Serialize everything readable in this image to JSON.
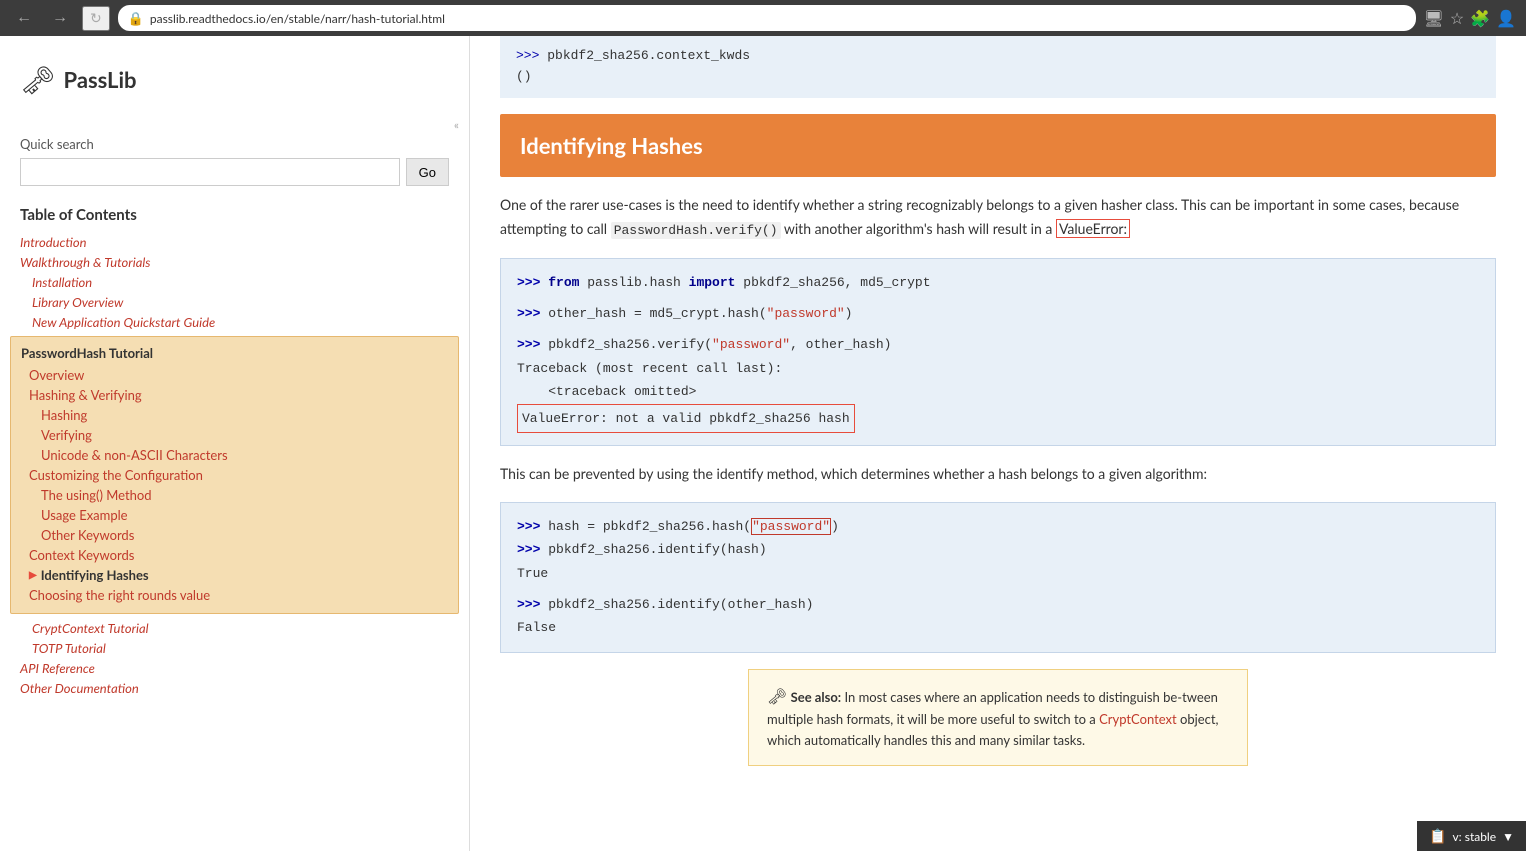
{
  "browser": {
    "url": "passlib.readthedocs.io/en/stable/narr/hash-tutorial.html",
    "back_label": "←",
    "forward_label": "→",
    "refresh_label": "↻",
    "lock_icon": "🔒"
  },
  "sidebar": {
    "logo_icon": "🗝",
    "logo_text": "PassLib",
    "quick_search_label": "Quick search",
    "search_placeholder": "",
    "go_button": "Go",
    "toc_label": "Table of Contents",
    "collapse_icon": "«",
    "nav_items": [
      {
        "label": "Introduction",
        "level": 1,
        "italic": true
      },
      {
        "label": "Walkthrough & Tutorials",
        "level": 1,
        "italic": true
      },
      {
        "label": "Installation",
        "level": 2,
        "italic": true
      },
      {
        "label": "Library Overview",
        "level": 2,
        "italic": true
      },
      {
        "label": "New Application Quickstart Guide",
        "level": 2,
        "italic": true
      }
    ],
    "active_section": {
      "title": "PasswordHash Tutorial",
      "items": [
        {
          "label": "Overview",
          "level": 1
        },
        {
          "label": "Hashing & Verifying",
          "level": 1
        },
        {
          "label": "Hashing",
          "level": 2
        },
        {
          "label": "Verifying",
          "level": 2
        },
        {
          "label": "Unicode & non-ASCII Characters",
          "level": 2
        },
        {
          "label": "Customizing the Configuration",
          "level": 1
        },
        {
          "label": "The using() Method",
          "level": 2
        },
        {
          "label": "Usage Example",
          "level": 2
        },
        {
          "label": "Other Keywords",
          "level": 2
        },
        {
          "label": "Context Keywords",
          "level": 1
        },
        {
          "label": "Identifying Hashes",
          "level": 1,
          "current": true
        },
        {
          "label": "Choosing the right rounds value",
          "level": 1
        }
      ]
    },
    "after_items": [
      {
        "label": "CryptContext Tutorial",
        "level": 1,
        "italic": true
      },
      {
        "label": "TOTP Tutorial",
        "level": 1,
        "italic": true
      },
      {
        "label": "API Reference",
        "level": 0,
        "italic": true
      },
      {
        "label": "Other Documentation",
        "level": 0,
        "italic": true
      }
    ]
  },
  "content": {
    "code_top_lines": [
      ">>> pbkdf2_sha256.context_kwds",
      "()"
    ],
    "section_heading": "Identifying Hashes",
    "paragraph1_parts": [
      {
        "type": "text",
        "text": "One of the rarer use-cases is the need to identify whether a string recognizably belongs to a given hasher class. This can be important in some cases, because attempting to call "
      },
      {
        "type": "code",
        "text": "PasswordHash.verify()"
      },
      {
        "type": "text",
        "text": " with another "
      }
    ],
    "paragraph1_line2": "algorithm's hash will result in a ValueError:",
    "code_block1": {
      "lines": [
        {
          "type": "prompt",
          "text": ">>> ",
          "rest_type": "mixed",
          "parts": [
            {
              "type": "keyword",
              "text": "from"
            },
            {
              "type": "normal",
              "text": " passlib.hash "
            },
            {
              "type": "keyword",
              "text": "import"
            },
            {
              "type": "normal",
              "text": " pbkdf2_sha256, md5_crypt"
            }
          ]
        },
        {
          "type": "blank"
        },
        {
          "type": "prompt",
          "text": ">>> ",
          "rest_type": "normal",
          "text2": "other_hash = md5_crypt.hash(",
          "parts": [
            {
              "type": "normal",
              "text": "other_hash = md5_crypt.hash("
            },
            {
              "type": "string",
              "text": "\"password\""
            },
            {
              "type": "normal",
              "text": ")"
            }
          ]
        },
        {
          "type": "blank"
        },
        {
          "type": "prompt",
          "text": ">>> ",
          "parts": [
            {
              "type": "normal",
              "text": "pbkdf2_sha256.verify("
            },
            {
              "type": "string",
              "text": "\"password\""
            },
            {
              "type": "normal",
              "text": ", other_hash)"
            }
          ]
        },
        {
          "type": "plain",
          "text": "Traceback (most recent call last):"
        },
        {
          "type": "plain",
          "text": "    <traceback omitted>"
        },
        {
          "type": "error_box",
          "text": "ValueError: not a valid pbkdf2_sha256 hash"
        }
      ]
    },
    "paragraph2": "This can be prevented by using the identify method, which determines whether a hash belongs to a given algorithm:",
    "code_block2": {
      "lines": [
        {
          "type": "prompt",
          "parts": [
            {
              "type": "normal",
              "text": "hash = pbkdf2_sha256.hash("
            },
            {
              "type": "string_box",
              "text": "\"password\""
            },
            {
              "type": "normal",
              "text": ")"
            }
          ]
        },
        {
          "type": "prompt",
          "parts": [
            {
              "type": "normal",
              "text": "pbkdf2_sha256.identify(hash)"
            }
          ]
        },
        {
          "type": "plain",
          "text": "True"
        },
        {
          "type": "blank"
        },
        {
          "type": "prompt",
          "parts": [
            {
              "type": "normal",
              "text": "pbkdf2_sha256.identify(other_hash)"
            }
          ]
        },
        {
          "type": "plain",
          "text": "False"
        }
      ]
    },
    "see_also": {
      "icon": "🗝",
      "bold": "See also:",
      "text1": "  In most cases where an application needs to distinguish be-tween multiple hash formats, it will be more useful to switch to a ",
      "link": "CryptContext",
      "text2": " object, which automatically handles this and many similar tasks."
    }
  },
  "version_badge": {
    "icon": "📋",
    "text": "v: stable",
    "dropdown": "▼"
  }
}
